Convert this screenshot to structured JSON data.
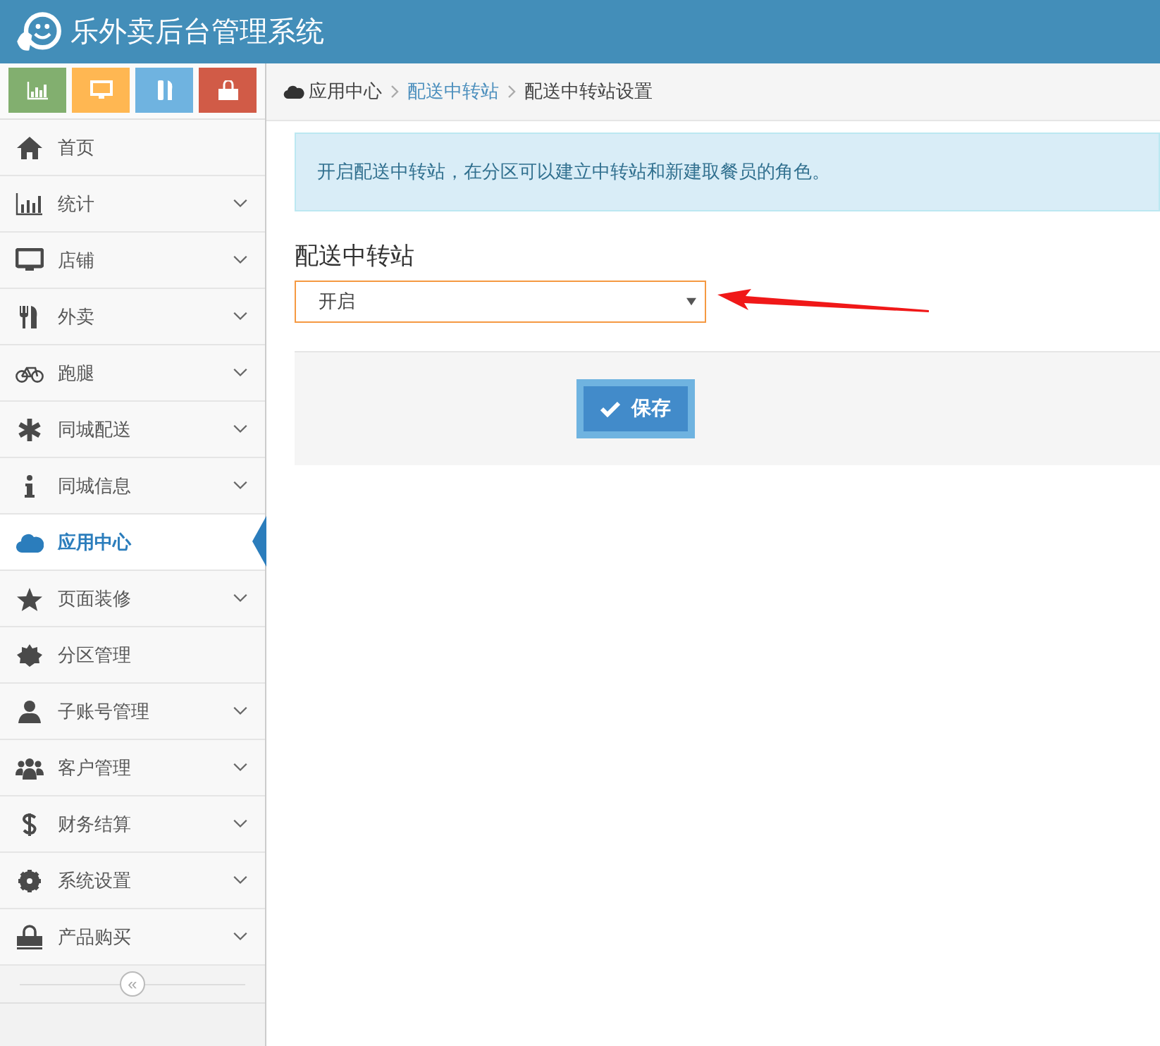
{
  "header": {
    "title": "乐外卖后台管理系统"
  },
  "shortcuts": [
    {
      "kind": "chart",
      "color": "#82af6f"
    },
    {
      "kind": "monitor",
      "color": "#ffb752"
    },
    {
      "kind": "food",
      "color": "#6fb3e0"
    },
    {
      "kind": "bag",
      "color": "#d15b47"
    }
  ],
  "sidebar": {
    "items": [
      {
        "label": "首页",
        "kind": "home",
        "expandable": false,
        "selected": false
      },
      {
        "label": "统计",
        "kind": "chart",
        "expandable": true,
        "selected": false
      },
      {
        "label": "店铺",
        "kind": "monitor",
        "expandable": true,
        "selected": false
      },
      {
        "label": "外卖",
        "kind": "food",
        "expandable": true,
        "selected": false
      },
      {
        "label": "跑腿",
        "kind": "bike",
        "expandable": true,
        "selected": false
      },
      {
        "label": "同城配送",
        "kind": "asterisk",
        "expandable": true,
        "selected": false
      },
      {
        "label": "同城信息",
        "kind": "info",
        "expandable": true,
        "selected": false
      },
      {
        "label": "应用中心",
        "kind": "cloud",
        "expandable": false,
        "selected": true
      },
      {
        "label": "页面装修",
        "kind": "star",
        "expandable": true,
        "selected": false
      },
      {
        "label": "分区管理",
        "kind": "burst",
        "expandable": false,
        "selected": false
      },
      {
        "label": "子账号管理",
        "kind": "user",
        "expandable": true,
        "selected": false
      },
      {
        "label": "客户管理",
        "kind": "users",
        "expandable": true,
        "selected": false
      },
      {
        "label": "财务结算",
        "kind": "dollar",
        "expandable": true,
        "selected": false
      },
      {
        "label": "系统设置",
        "kind": "gear",
        "expandable": true,
        "selected": false
      },
      {
        "label": "产品购买",
        "kind": "bag",
        "expandable": true,
        "selected": false
      }
    ],
    "collapse": "«"
  },
  "breadcrumb": [
    {
      "label": "应用中心",
      "kind": "home"
    },
    {
      "label": "配送中转站",
      "kind": "link"
    },
    {
      "label": "配送中转站设置",
      "kind": "current"
    }
  ],
  "alert": "开启配送中转站，在分区可以建立中转站和新建取餐员的角色。",
  "form": {
    "label": "配送中转站",
    "select": {
      "value": "开启"
    },
    "save_button": "保存"
  }
}
